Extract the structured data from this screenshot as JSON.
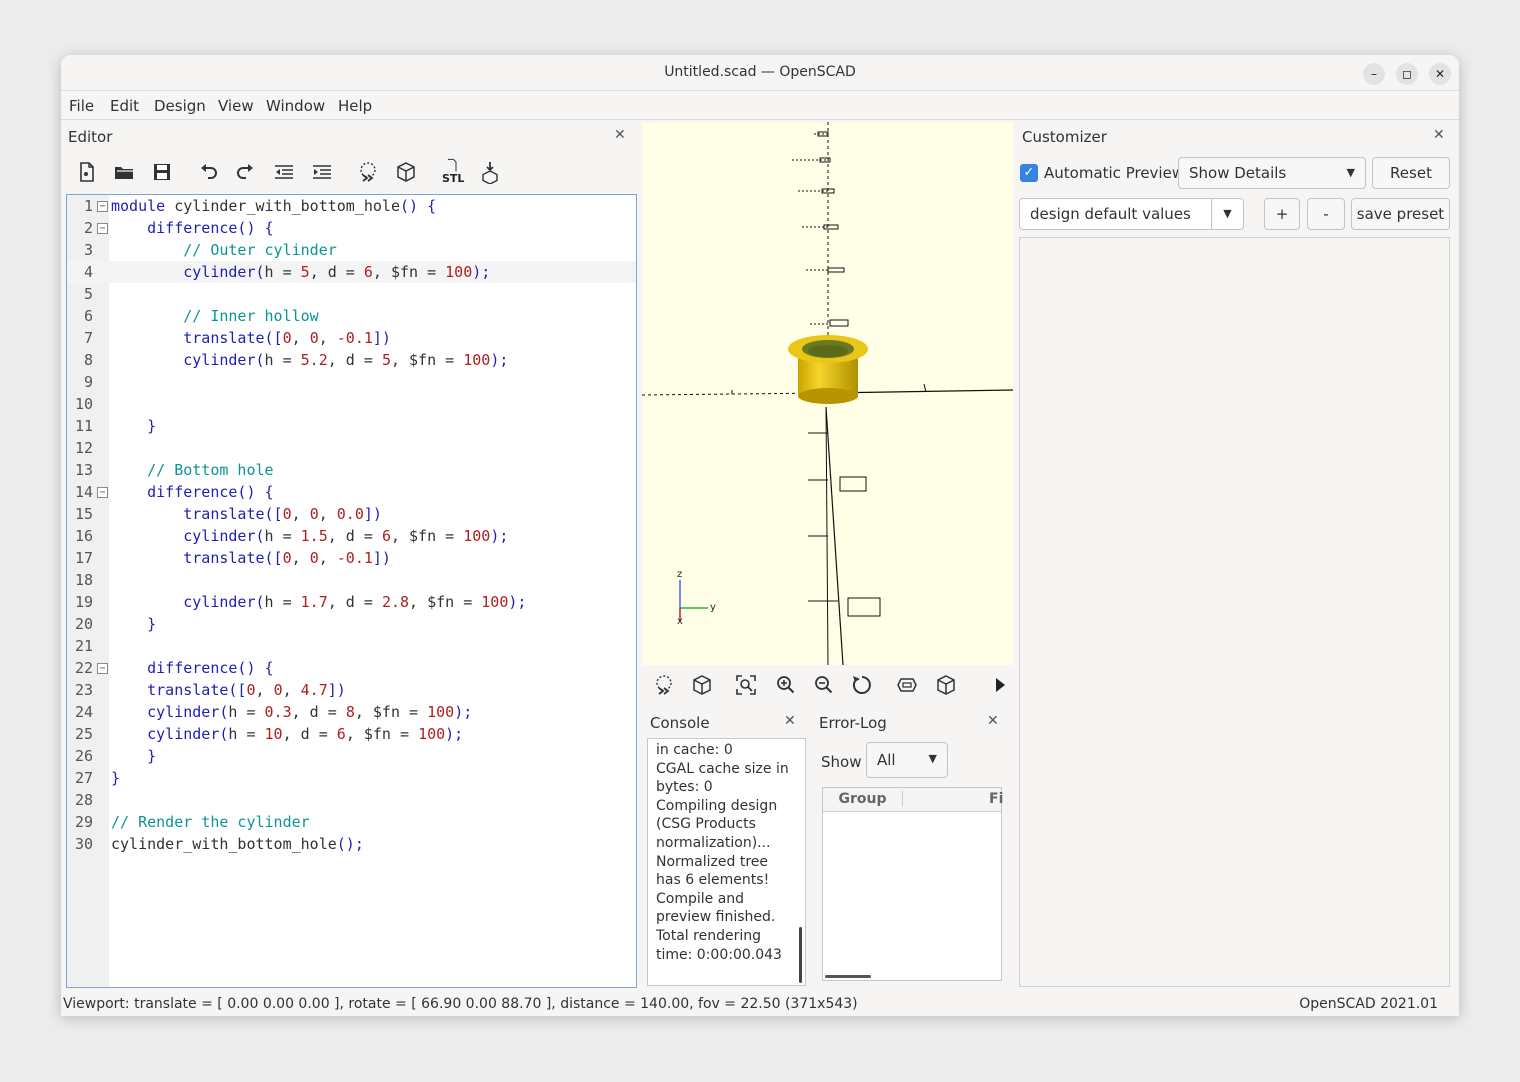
{
  "window": {
    "title": "Untitled.scad — OpenSCAD"
  },
  "window_controls": {
    "minimize": "–",
    "maximize": "◻",
    "close": "✕"
  },
  "menu": [
    "File",
    "Edit",
    "Design",
    "View",
    "Window",
    "Help"
  ],
  "editor": {
    "title": "Editor",
    "close": "✕",
    "toolbar_icons": [
      "new-file-icon",
      "open-file-icon",
      "save-icon",
      "undo-icon",
      "redo-icon",
      "unindent-icon",
      "indent-icon",
      "preview-icon",
      "render-icon",
      "export-stl-icon",
      "send-to-3d-print-icon"
    ],
    "stl_label": "STL",
    "fold_open_glyph": "−",
    "active_line": 4,
    "lines": [
      {
        "num": "1",
        "fold": true,
        "html": "<span style=\"color:#1f1fb0\">module</span> cylinder_with_bottom_hole<span style=\"color:#1f1fb0\">() {</span>"
      },
      {
        "num": "2",
        "fold": true,
        "html": "    <span style=\"color:#1f1fb0\">difference() {</span>"
      },
      {
        "num": "3",
        "fold": false,
        "html": "        <span style=\"color:#0d9494\">// Outer cylinder</span>"
      },
      {
        "num": "4",
        "fold": false,
        "html": "        <span style=\"color:#1f1fb0\">cylinder(</span>h = <span style=\"color:#b01e1e\">5</span>, d = <span style=\"color:#b01e1e\">6</span>, $fn = <span style=\"color:#b01e1e\">100</span><span style=\"color:#1f1fb0\">);</span>"
      },
      {
        "num": "5",
        "fold": false,
        "html": ""
      },
      {
        "num": "6",
        "fold": false,
        "html": "        <span style=\"color:#0d9494\">// Inner hollow</span>"
      },
      {
        "num": "7",
        "fold": false,
        "html": "        <span style=\"color:#1f1fb0\">translate([</span><span style=\"color:#b01e1e\">0</span>, <span style=\"color:#b01e1e\">0</span>, <span style=\"color:#b01e1e\">-0.1</span><span style=\"color:#1f1fb0\">])</span>"
      },
      {
        "num": "8",
        "fold": false,
        "html": "        <span style=\"color:#1f1fb0\">cylinder(</span>h = <span style=\"color:#b01e1e\">5.2</span>, d = <span style=\"color:#b01e1e\">5</span>, $fn = <span style=\"color:#b01e1e\">100</span><span style=\"color:#1f1fb0\">);</span>"
      },
      {
        "num": "9",
        "fold": false,
        "html": ""
      },
      {
        "num": "10",
        "fold": false,
        "html": ""
      },
      {
        "num": "11",
        "fold": false,
        "html": "    <span style=\"color:#1f1fb0\">}</span>"
      },
      {
        "num": "12",
        "fold": false,
        "html": ""
      },
      {
        "num": "13",
        "fold": false,
        "html": "    <span style=\"color:#0d9494\">// Bottom hole</span>"
      },
      {
        "num": "14",
        "fold": true,
        "html": "    <span style=\"color:#1f1fb0\">difference() {</span>"
      },
      {
        "num": "15",
        "fold": false,
        "html": "        <span style=\"color:#1f1fb0\">translate([</span><span style=\"color:#b01e1e\">0</span>, <span style=\"color:#b01e1e\">0</span>, <span style=\"color:#b01e1e\">0.0</span><span style=\"color:#1f1fb0\">])</span>"
      },
      {
        "num": "16",
        "fold": false,
        "html": "        <span style=\"color:#1f1fb0\">cylinder(</span>h = <span style=\"color:#b01e1e\">1.5</span>, d = <span style=\"color:#b01e1e\">6</span>, $fn = <span style=\"color:#b01e1e\">100</span><span style=\"color:#1f1fb0\">);</span>"
      },
      {
        "num": "17",
        "fold": false,
        "html": "        <span style=\"color:#1f1fb0\">translate([</span><span style=\"color:#b01e1e\">0</span>, <span style=\"color:#b01e1e\">0</span>, <span style=\"color:#b01e1e\">-0.1</span><span style=\"color:#1f1fb0\">])</span>"
      },
      {
        "num": "18",
        "fold": false,
        "html": ""
      },
      {
        "num": "19",
        "fold": false,
        "html": "        <span style=\"color:#1f1fb0\">cylinder(</span>h = <span style=\"color:#b01e1e\">1.7</span>, d = <span style=\"color:#b01e1e\">2.8</span>, $fn = <span style=\"color:#b01e1e\">100</span><span style=\"color:#1f1fb0\">);</span>"
      },
      {
        "num": "20",
        "fold": false,
        "html": "    <span style=\"color:#1f1fb0\">}</span>"
      },
      {
        "num": "21",
        "fold": false,
        "html": ""
      },
      {
        "num": "22",
        "fold": true,
        "html": "    <span style=\"color:#1f1fb0\">difference() {</span>"
      },
      {
        "num": "23",
        "fold": false,
        "html": "    <span style=\"color:#1f1fb0\">translate([</span><span style=\"color:#b01e1e\">0</span>, <span style=\"color:#b01e1e\">0</span>, <span style=\"color:#b01e1e\">4.7</span><span style=\"color:#1f1fb0\">])</span>"
      },
      {
        "num": "24",
        "fold": false,
        "html": "    <span style=\"color:#1f1fb0\">cylinder(</span>h = <span style=\"color:#b01e1e\">0.3</span>, d = <span style=\"color:#b01e1e\">8</span>, $fn = <span style=\"color:#b01e1e\">100</span><span style=\"color:#1f1fb0\">);</span>"
      },
      {
        "num": "25",
        "fold": false,
        "html": "    <span style=\"color:#1f1fb0\">cylinder(</span>h = <span style=\"color:#b01e1e\">10</span>, d = <span style=\"color:#b01e1e\">6</span>, $fn = <span style=\"color:#b01e1e\">100</span><span style=\"color:#1f1fb0\">);</span>"
      },
      {
        "num": "26",
        "fold": false,
        "html": "    <span style=\"color:#1f1fb0\">}</span>"
      },
      {
        "num": "27",
        "fold": false,
        "html": "<span style=\"color:#1f1fb0\">}</span>"
      },
      {
        "num": "28",
        "fold": false,
        "html": ""
      },
      {
        "num": "29",
        "fold": false,
        "html": "<span style=\"color:#0d9494\">// Render the cylinder</span>"
      },
      {
        "num": "30",
        "fold": false,
        "html": "cylinder_with_bottom_hole<span style=\"color:#1f1fb0\">();</span>"
      }
    ]
  },
  "viewport": {
    "axis_labels": {
      "z": "z",
      "y": "y",
      "x": "x"
    },
    "toolbar_icons": [
      "preview-icon",
      "render-icon",
      "view-all-icon",
      "zoom-in-icon",
      "zoom-out-icon",
      "reset-view-icon",
      "perspective-icon",
      "orthogonal-icon",
      "more-icon"
    ]
  },
  "console": {
    "title": "Console",
    "close": "✕",
    "lines": [
      "in cache: 0",
      "CGAL cache size in",
      "bytes: 0",
      "Compiling design",
      "(CSG Products",
      "normalization)...",
      "Normalized tree",
      "has 6 elements!",
      "Compile and",
      "preview finished.",
      "Total rendering",
      "time: 0:00:00.043"
    ]
  },
  "error_log": {
    "title": "Error-Log",
    "close": "✕",
    "show_label": "Show",
    "show_value": "All",
    "columns": [
      "Group",
      "Fi"
    ]
  },
  "customizer": {
    "title": "Customizer",
    "close": "✕",
    "auto_preview_label": "Automatic Preview",
    "auto_preview_checked": true,
    "details_value": "Show Details",
    "reset_label": "Reset",
    "preset_value": "design default values",
    "add_label": "+",
    "remove_label": "-",
    "save_preset_label": "save preset"
  },
  "status": {
    "left": "Viewport: translate = [ 0.00 0.00 0.00 ], rotate = [ 66.90 0.00 88.70 ], distance = 140.00, fov = 22.50 (371x543)",
    "right": "OpenSCAD 2021.01"
  },
  "colors": {
    "accent": "#3584e4",
    "model_yellow": "#f3d026",
    "viewport_bg": "#ffffe8"
  }
}
